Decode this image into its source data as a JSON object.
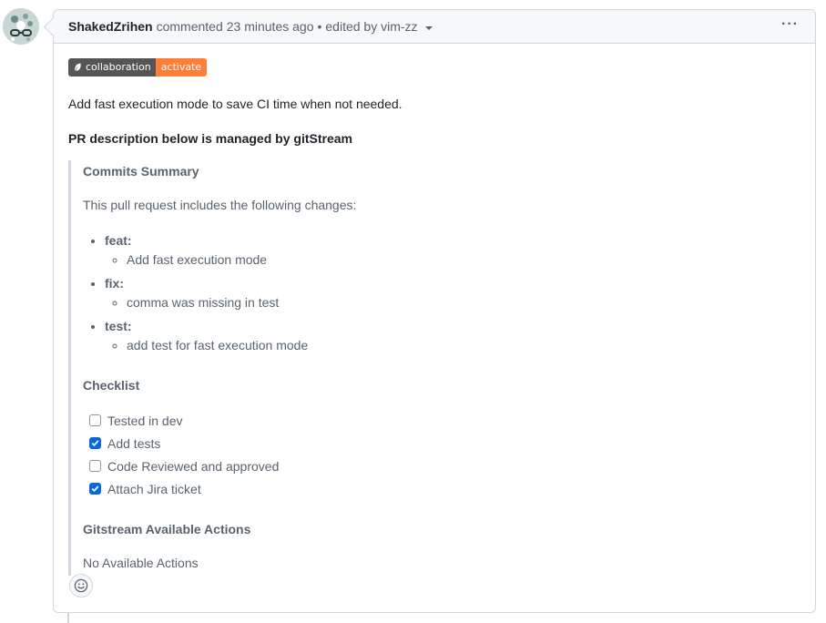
{
  "header": {
    "author": "ShakedZrihen",
    "action": "commented",
    "time": "23 minutes ago",
    "separator": "•",
    "edited_by": "edited by vim-zz",
    "more_actions_glyph": "···"
  },
  "badge": {
    "label": "collaboration",
    "value": "activate",
    "label_color": "#555555",
    "value_color": "#fe7d37"
  },
  "body": {
    "intro": "Add fast execution mode to save CI time when not needed.",
    "managed_note": "PR description below is managed by gitStream"
  },
  "summary": {
    "heading": "Commits Summary",
    "intro": "This pull request includes the following changes:",
    "groups": [
      {
        "type": "feat:",
        "items": [
          "Add fast execution mode"
        ]
      },
      {
        "type": "fix:",
        "items": [
          "comma was missing in test"
        ]
      },
      {
        "type": "test:",
        "items": [
          "add test for fast execution mode"
        ]
      }
    ]
  },
  "checklist": {
    "heading": "Checklist",
    "items": [
      {
        "label": "Tested in dev",
        "checked": false
      },
      {
        "label": "Add tests",
        "checked": true
      },
      {
        "label": "Code Reviewed and approved",
        "checked": false
      },
      {
        "label": "Attach Jira ticket",
        "checked": true
      }
    ]
  },
  "actions": {
    "heading": "Gitstream Available Actions",
    "text": "No Available Actions"
  },
  "icons": {
    "avatar": "avatar-icon",
    "reaction": "smiley-icon",
    "kebab": "kebab-horizontal-icon",
    "caret": "triangle-down-icon",
    "badge": "leaf-icon"
  },
  "colors": {
    "accent": "#0969da",
    "border": "#d0d7de",
    "header_bg": "#f6f8fa",
    "muted_text": "#59636e"
  }
}
